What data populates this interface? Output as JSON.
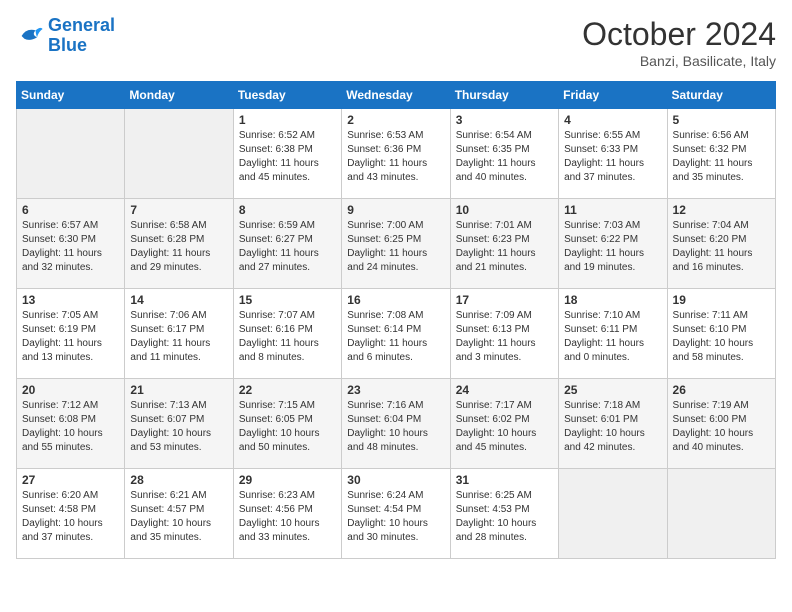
{
  "header": {
    "logo_line1": "General",
    "logo_line2": "Blue",
    "title": "October 2024",
    "subtitle": "Banzi, Basilicate, Italy"
  },
  "days_of_week": [
    "Sunday",
    "Monday",
    "Tuesday",
    "Wednesday",
    "Thursday",
    "Friday",
    "Saturday"
  ],
  "weeks": [
    [
      {
        "day": "",
        "empty": true
      },
      {
        "day": "",
        "empty": true
      },
      {
        "day": "1",
        "sunrise": "6:52 AM",
        "sunset": "6:38 PM",
        "daylight": "11 hours and 45 minutes."
      },
      {
        "day": "2",
        "sunrise": "6:53 AM",
        "sunset": "6:36 PM",
        "daylight": "11 hours and 43 minutes."
      },
      {
        "day": "3",
        "sunrise": "6:54 AM",
        "sunset": "6:35 PM",
        "daylight": "11 hours and 40 minutes."
      },
      {
        "day": "4",
        "sunrise": "6:55 AM",
        "sunset": "6:33 PM",
        "daylight": "11 hours and 37 minutes."
      },
      {
        "day": "5",
        "sunrise": "6:56 AM",
        "sunset": "6:32 PM",
        "daylight": "11 hours and 35 minutes."
      }
    ],
    [
      {
        "day": "6",
        "sunrise": "6:57 AM",
        "sunset": "6:30 PM",
        "daylight": "11 hours and 32 minutes."
      },
      {
        "day": "7",
        "sunrise": "6:58 AM",
        "sunset": "6:28 PM",
        "daylight": "11 hours and 29 minutes."
      },
      {
        "day": "8",
        "sunrise": "6:59 AM",
        "sunset": "6:27 PM",
        "daylight": "11 hours and 27 minutes."
      },
      {
        "day": "9",
        "sunrise": "7:00 AM",
        "sunset": "6:25 PM",
        "daylight": "11 hours and 24 minutes."
      },
      {
        "day": "10",
        "sunrise": "7:01 AM",
        "sunset": "6:23 PM",
        "daylight": "11 hours and 21 minutes."
      },
      {
        "day": "11",
        "sunrise": "7:03 AM",
        "sunset": "6:22 PM",
        "daylight": "11 hours and 19 minutes."
      },
      {
        "day": "12",
        "sunrise": "7:04 AM",
        "sunset": "6:20 PM",
        "daylight": "11 hours and 16 minutes."
      }
    ],
    [
      {
        "day": "13",
        "sunrise": "7:05 AM",
        "sunset": "6:19 PM",
        "daylight": "11 hours and 13 minutes."
      },
      {
        "day": "14",
        "sunrise": "7:06 AM",
        "sunset": "6:17 PM",
        "daylight": "11 hours and 11 minutes."
      },
      {
        "day": "15",
        "sunrise": "7:07 AM",
        "sunset": "6:16 PM",
        "daylight": "11 hours and 8 minutes."
      },
      {
        "day": "16",
        "sunrise": "7:08 AM",
        "sunset": "6:14 PM",
        "daylight": "11 hours and 6 minutes."
      },
      {
        "day": "17",
        "sunrise": "7:09 AM",
        "sunset": "6:13 PM",
        "daylight": "11 hours and 3 minutes."
      },
      {
        "day": "18",
        "sunrise": "7:10 AM",
        "sunset": "6:11 PM",
        "daylight": "11 hours and 0 minutes."
      },
      {
        "day": "19",
        "sunrise": "7:11 AM",
        "sunset": "6:10 PM",
        "daylight": "10 hours and 58 minutes."
      }
    ],
    [
      {
        "day": "20",
        "sunrise": "7:12 AM",
        "sunset": "6:08 PM",
        "daylight": "10 hours and 55 minutes."
      },
      {
        "day": "21",
        "sunrise": "7:13 AM",
        "sunset": "6:07 PM",
        "daylight": "10 hours and 53 minutes."
      },
      {
        "day": "22",
        "sunrise": "7:15 AM",
        "sunset": "6:05 PM",
        "daylight": "10 hours and 50 minutes."
      },
      {
        "day": "23",
        "sunrise": "7:16 AM",
        "sunset": "6:04 PM",
        "daylight": "10 hours and 48 minutes."
      },
      {
        "day": "24",
        "sunrise": "7:17 AM",
        "sunset": "6:02 PM",
        "daylight": "10 hours and 45 minutes."
      },
      {
        "day": "25",
        "sunrise": "7:18 AM",
        "sunset": "6:01 PM",
        "daylight": "10 hours and 42 minutes."
      },
      {
        "day": "26",
        "sunrise": "7:19 AM",
        "sunset": "6:00 PM",
        "daylight": "10 hours and 40 minutes."
      }
    ],
    [
      {
        "day": "27",
        "sunrise": "6:20 AM",
        "sunset": "4:58 PM",
        "daylight": "10 hours and 37 minutes."
      },
      {
        "day": "28",
        "sunrise": "6:21 AM",
        "sunset": "4:57 PM",
        "daylight": "10 hours and 35 minutes."
      },
      {
        "day": "29",
        "sunrise": "6:23 AM",
        "sunset": "4:56 PM",
        "daylight": "10 hours and 33 minutes."
      },
      {
        "day": "30",
        "sunrise": "6:24 AM",
        "sunset": "4:54 PM",
        "daylight": "10 hours and 30 minutes."
      },
      {
        "day": "31",
        "sunrise": "6:25 AM",
        "sunset": "4:53 PM",
        "daylight": "10 hours and 28 minutes."
      },
      {
        "day": "",
        "empty": true
      },
      {
        "day": "",
        "empty": true
      }
    ]
  ]
}
